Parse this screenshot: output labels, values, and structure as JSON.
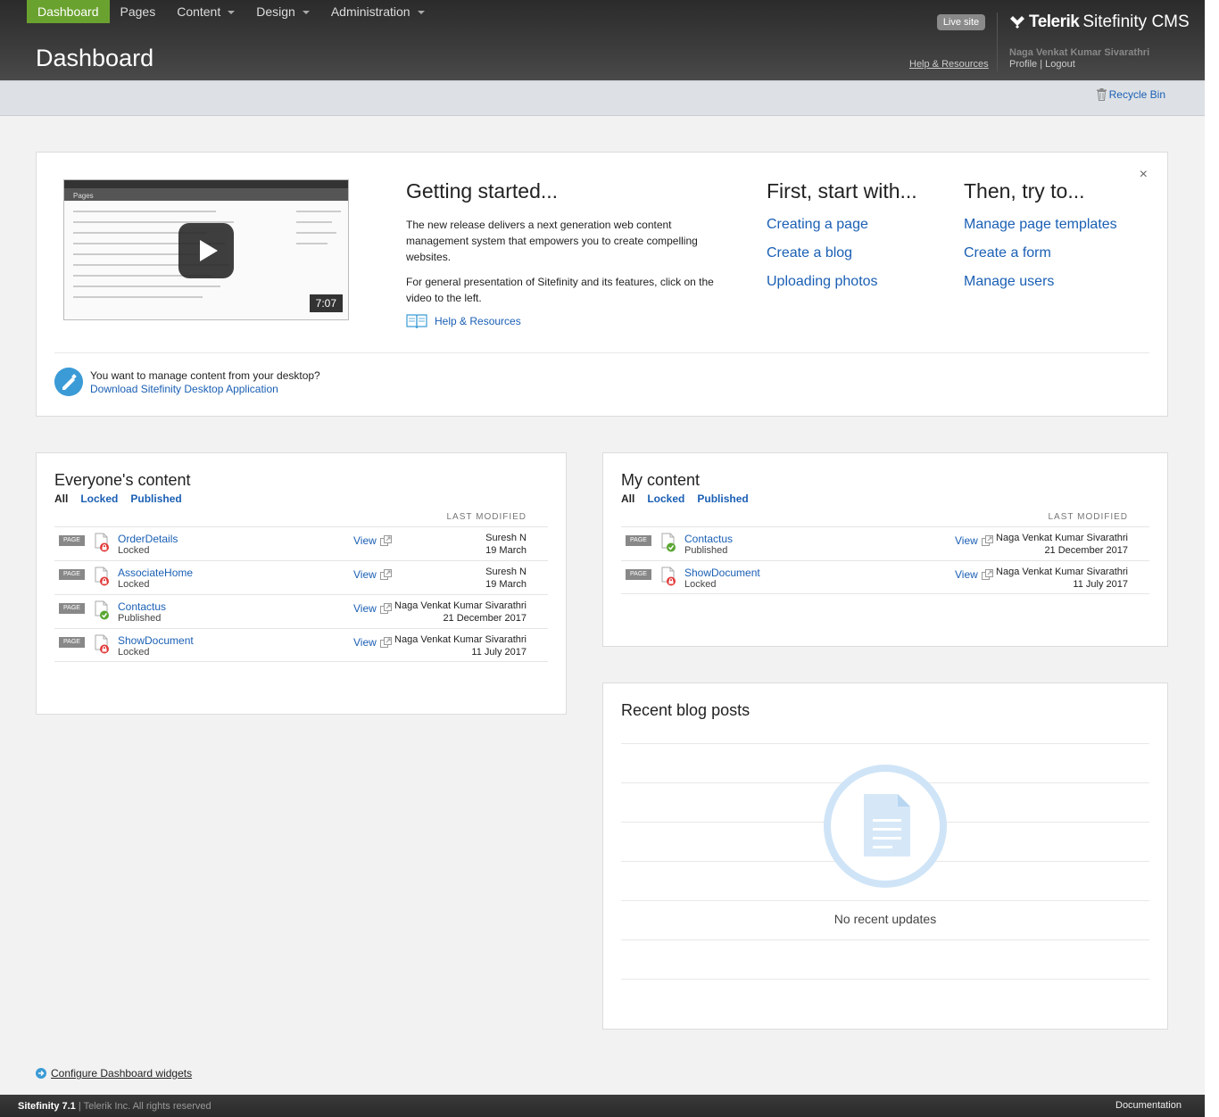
{
  "nav": {
    "items": [
      {
        "label": "Dashboard",
        "active": true,
        "dropdown": false
      },
      {
        "label": "Pages",
        "active": false,
        "dropdown": false
      },
      {
        "label": "Content",
        "active": false,
        "dropdown": true
      },
      {
        "label": "Design",
        "active": false,
        "dropdown": true
      },
      {
        "label": "Administration",
        "active": false,
        "dropdown": true
      }
    ]
  },
  "header": {
    "page_title": "Dashboard",
    "live_site": "Live site",
    "help_link": "Help & Resources",
    "logo_bold": "Telerik",
    "logo_light": "Sitefinity CMS",
    "user_name": "Naga Venkat Kumar Sivarathri",
    "profile": "Profile",
    "separator": "|",
    "logout": "Logout"
  },
  "toolbar": {
    "recycle_bin": "Recycle Bin"
  },
  "getting_started": {
    "title": "Getting started...",
    "desc1": "The new release delivers a next generation web content management system that empowers you to create compelling websites.",
    "desc2": "For general presentation of Sitefinity and its features, click on the video to the left.",
    "help_link": "Help & Resources",
    "video_duration": "7:07",
    "video_screen_label": "Pages",
    "close": "×",
    "first_title": "First, start with...",
    "first_links": [
      "Creating a page",
      "Create a blog",
      "Uploading photos"
    ],
    "then_title": "Then, try to...",
    "then_links": [
      "Manage page templates",
      "Create a form",
      "Manage users"
    ],
    "desktop_question": "You want to manage content from your desktop?",
    "desktop_link": "Download Sitefinity Desktop Application"
  },
  "everyone": {
    "title": "Everyone's content",
    "filters": [
      "All",
      "Locked",
      "Published"
    ],
    "col_head": "LAST MODIFIED",
    "badge": "PAGE",
    "view": "View",
    "rows": [
      {
        "title": "OrderDetails",
        "status": "Locked",
        "by": "Suresh N",
        "date": "19 March"
      },
      {
        "title": "AssociateHome",
        "status": "Locked",
        "by": "Suresh N",
        "date": "19 March"
      },
      {
        "title": "Contactus",
        "status": "Published",
        "by": "Naga Venkat Kumar Sivarathri",
        "date": "21 December 2017"
      },
      {
        "title": "ShowDocument",
        "status": "Locked",
        "by": "Naga Venkat Kumar Sivarathri",
        "date": "11 July 2017"
      }
    ]
  },
  "mine": {
    "title": "My content",
    "filters": [
      "All",
      "Locked",
      "Published"
    ],
    "col_head": "LAST MODIFIED",
    "badge": "PAGE",
    "view": "View",
    "rows": [
      {
        "title": "Contactus",
        "status": "Published",
        "by": "Naga Venkat Kumar Sivarathri",
        "date": "21 December 2017"
      },
      {
        "title": "ShowDocument",
        "status": "Locked",
        "by": "Naga Venkat Kumar Sivarathri",
        "date": "11 July 2017"
      }
    ]
  },
  "blog": {
    "title": "Recent blog posts",
    "empty": "No recent updates"
  },
  "configure": "Configure Dashboard widgets",
  "footer": {
    "product": "Sitefinity 7.1",
    "copyright": " | Telerik Inc. All rights reserved",
    "documentation": "Documentation"
  },
  "colors": {
    "nav_active": "#6aa22f",
    "link": "#1a5fb4",
    "locked": "#e23b3b",
    "published": "#5aa632"
  }
}
